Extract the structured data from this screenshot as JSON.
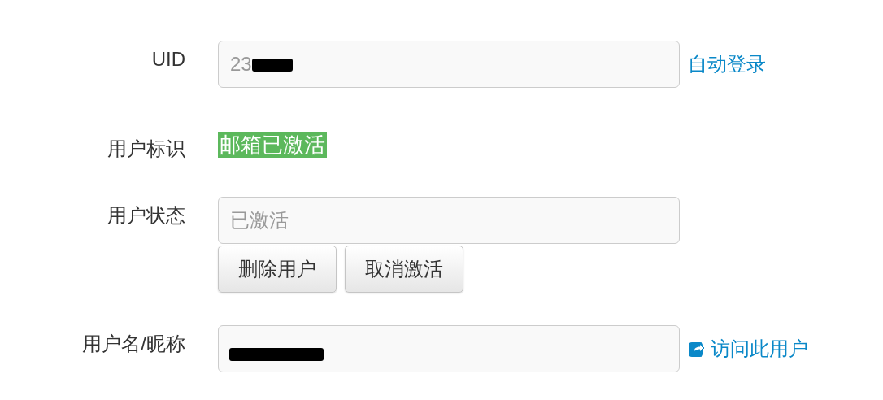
{
  "rows": [
    {
      "kind": "field",
      "label": "UID",
      "value": "23",
      "redacted": true,
      "link": {
        "text": "自动登录",
        "icon": false
      }
    },
    {
      "kind": "badge",
      "label": "用户标识",
      "badge": "邮箱已激活",
      "color": "#5cb85c"
    },
    {
      "kind": "field",
      "label": "用户状态",
      "placeholder": "已激活",
      "redacted": false,
      "buttons": [
        "删除用户",
        "取消激活"
      ]
    },
    {
      "kind": "field",
      "label": "用户名/昵称",
      "value": "",
      "redacted": true,
      "link": {
        "text": "访问此用户",
        "icon": true
      }
    }
  ]
}
